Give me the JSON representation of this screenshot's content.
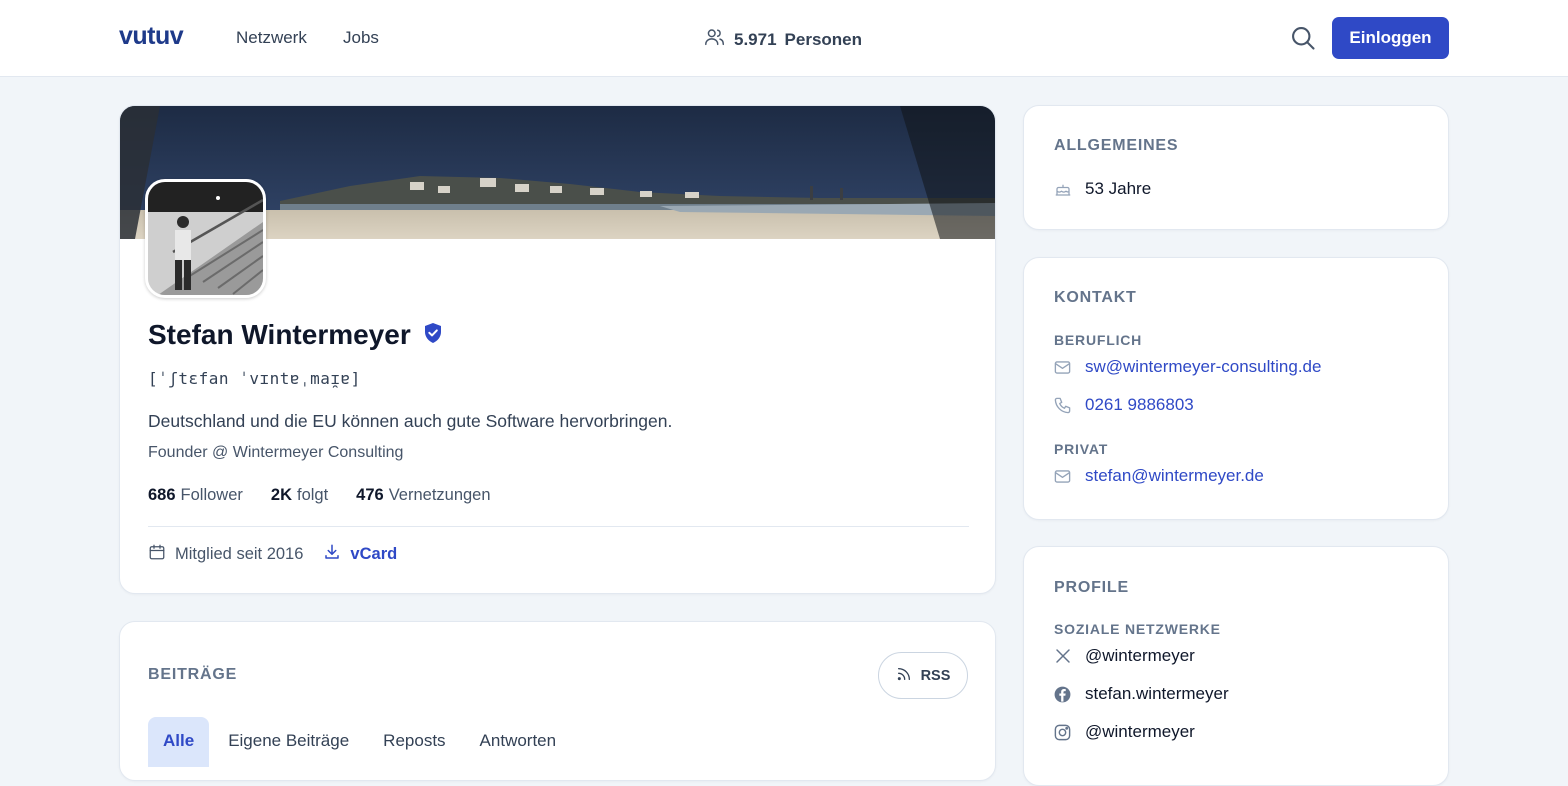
{
  "header": {
    "logo": "vutuv",
    "nav": [
      "Netzwerk",
      "Jobs"
    ],
    "people_count": "5.971",
    "people_label": "Personen",
    "login_label": "Einloggen"
  },
  "profile": {
    "name": "Stefan Wintermeyer",
    "phonetic": "[ˈʃtɛfan ˈvɪntɐˌmaɪ̯ɐ]",
    "bio": "Deutschland und die EU können auch gute Software hervorbringen.",
    "headline": "Founder @ Wintermeyer Consulting",
    "stats": [
      {
        "value": "686",
        "label": "Follower"
      },
      {
        "value": "2K",
        "label": "folgt"
      },
      {
        "value": "476",
        "label": "Vernetzungen"
      }
    ],
    "member_since": "Mitglied seit 2016",
    "vcard": "vCard"
  },
  "posts": {
    "title": "BEITRÄGE",
    "rss": "RSS",
    "tabs": [
      "Alle",
      "Eigene Beiträge",
      "Reposts",
      "Antworten"
    ],
    "active_tab": "Alle"
  },
  "sidebar": {
    "general": {
      "title": "ALLGEMEINES",
      "age": "53 Jahre"
    },
    "contact": {
      "title": "KONTAKT",
      "work_label": "BERUFLICH",
      "work_email": "sw@wintermeyer-consulting.de",
      "work_phone": "0261 9886803",
      "private_label": "PRIVAT",
      "private_email": "stefan@wintermeyer.de"
    },
    "profiles": {
      "title": "PROFILE",
      "social_label": "SOZIALE NETZWERKE",
      "items": [
        {
          "network": "x",
          "handle": "@wintermeyer"
        },
        {
          "network": "facebook",
          "handle": "stefan.wintermeyer"
        },
        {
          "network": "instagram",
          "handle": "@wintermeyer"
        }
      ]
    }
  },
  "colors": {
    "accent": "#2f49c6",
    "background": "#f1f5f9",
    "text": "#0f172a",
    "muted": "#64748b"
  }
}
